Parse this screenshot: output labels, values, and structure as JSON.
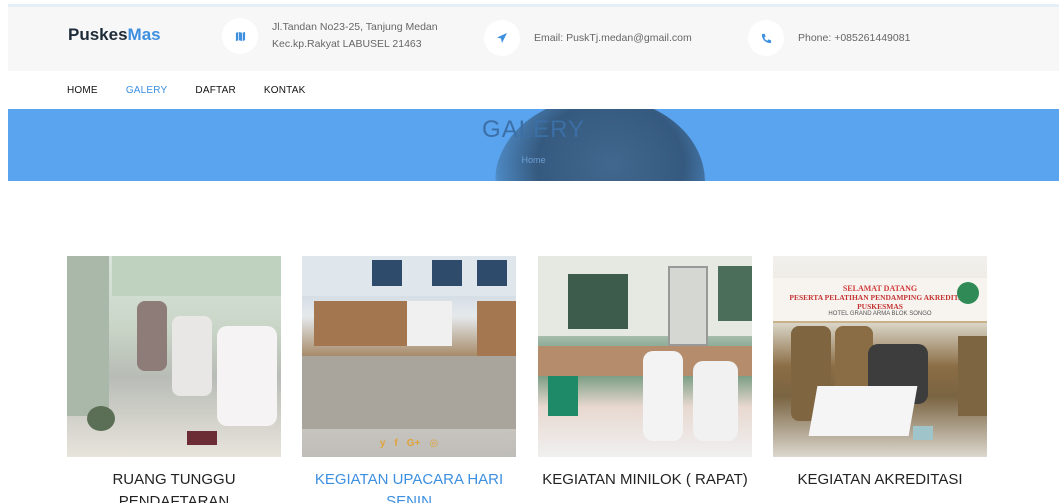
{
  "brand": {
    "name_dark": "Puskes",
    "name_accent": "Mas"
  },
  "contact": {
    "address_line1": "Jl.Tandan No23-25, Tanjung Medan",
    "address_line2": "Kec.kp.Rakyat LABUSEL 21463",
    "email": "Email: PuskTj.medan@gmail.com",
    "phone": "Phone: +085261449081",
    "icons": [
      "map-icon",
      "paper-plane-icon",
      "phone-icon"
    ]
  },
  "nav": {
    "items": [
      "HOME",
      "GALERY",
      "DAFTAR",
      "KONTAK"
    ],
    "active": "GALERY"
  },
  "hero": {
    "title": "GALERY",
    "breadcrumb": "Home"
  },
  "gallery": {
    "items": [
      {
        "caption": "RUANG TUNGGU PENDAFTARAN"
      },
      {
        "caption": "KEGIATAN UPACARA HARI SENIN"
      },
      {
        "caption": "KEGIATAN MINILOK ( RAPAT)"
      },
      {
        "caption": "KEGIATAN AKREDITASI"
      }
    ],
    "banner": {
      "line1": "SELAMAT DATANG",
      "line2": "PESERTA PELATIHAN PENDAMPING AKREDITASI PUSKESMAS",
      "line3": "HOTEL GRAND ARMA BLOK SONGO"
    },
    "social": {
      "twitter": "y",
      "facebook": "f",
      "google_plus": "G+",
      "instagram": "◎"
    }
  },
  "colors": {
    "accent": "#3d8fe0",
    "hero": "#5aa3ef",
    "dark_text": "#1d2b39"
  }
}
